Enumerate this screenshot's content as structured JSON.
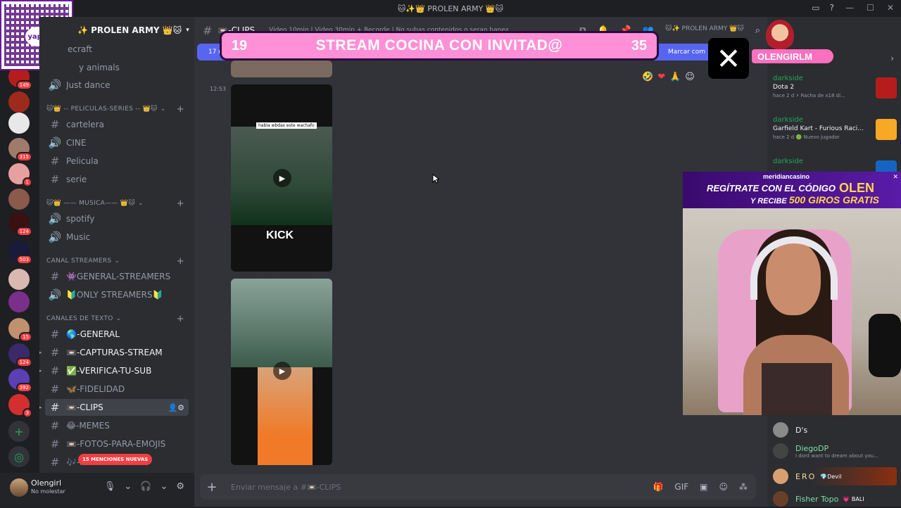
{
  "titlebar": {
    "title": "🐱✨👑 PROLEN ARMY 👑🐱"
  },
  "server": {
    "name": "✨ PROLEN ARMY 👑🐱"
  },
  "rail": {
    "badges": [
      "149",
      "315",
      "1",
      "124",
      "503",
      "15",
      "124",
      "392",
      "3"
    ]
  },
  "sidebar": {
    "channels_top": [
      {
        "label": "ecraft"
      },
      {
        "label": "y animals"
      },
      {
        "label": "Just dance"
      }
    ],
    "cat_peliculas": "🐱👑 -- PELICULAS-SERIES -- 👑🐱",
    "peliculas": [
      {
        "label": "cartelera",
        "icon": "#"
      },
      {
        "label": "CINE",
        "icon": "🔊"
      },
      {
        "label": "Pelicula",
        "icon": "#"
      },
      {
        "label": "serie",
        "icon": "#"
      }
    ],
    "cat_musica": "🐱👑 —— MUSICA—— 👑🐱",
    "musica": [
      {
        "label": "spotify"
      },
      {
        "label": "Music"
      }
    ],
    "cat_streamers": "CANAL STREAMERS",
    "streamers": [
      {
        "label": "👾GENERAL-STREAMERS"
      },
      {
        "label": "🔰ONLY STREAMERS🔰"
      }
    ],
    "cat_texto": "CANALES DE TEXTO",
    "texto": [
      {
        "label": "🌎-GENERAL"
      },
      {
        "label": "📼-CAPTURAS-STREAM"
      },
      {
        "label": "✅-VERIFICA-TU-SUB"
      },
      {
        "label": "🦋-FIDELIDAD"
      },
      {
        "label": "📼-CLIPS"
      },
      {
        "label": "😂-MEMES"
      },
      {
        "label": "📼-FOTOS-PARA-EMOJIS"
      },
      {
        "label": "🎶-M"
      }
    ],
    "mentions": "15 MENCIONES NUEVAS"
  },
  "user": {
    "name": "Olengirl",
    "status": "No molestar"
  },
  "main": {
    "channel": "📼-CLIPS",
    "header_topic": "Video 10min | Video 30min + Recorde | No subas contenidos o seran baneados",
    "banner_left": "17 m",
    "banner_right": "Marcar com",
    "timestamp": "12:53",
    "video1_caption": "habla wbdas este wachafo",
    "video1_brand": "KICK",
    "composer_placeholder": "Enviar mensaje a #📼-CLIPS"
  },
  "overlay": {
    "count_left": "19",
    "title": "STREAM COCINA CON INVITAD@",
    "count_right": "35",
    "streamer_tag": "OLENGIRLM"
  },
  "casino": {
    "brand": "meridiancasino",
    "line1": "REGÍTRATE CON EL CÓDIGO",
    "code": "OLEN",
    "line2_pre": "Y RECIBE ",
    "line2_amount": "500 GIROS GRATIS"
  },
  "activity": [
    {
      "who": "darkside",
      "game": "Dota 2",
      "meta": "hace 2 d ⚡ Racha de x18 dí..."
    },
    {
      "who": "darkside",
      "game": "Garfield Kart - Furious Raci...",
      "meta": "hace 2 d 🟢 Nuevo jugador"
    },
    {
      "who": "darkside",
      "game": "",
      "meta": ""
    }
  ],
  "members": [
    {
      "name": "D's",
      "sub": "",
      "tag": ""
    },
    {
      "name": "DiegoDP",
      "sub": "I dont want to dream about you...",
      "tag": ""
    },
    {
      "name": "ERO",
      "sub": "",
      "tag": "💎Devil"
    },
    {
      "name": "Fisher Topo",
      "sub": "",
      "tag": "💗 BALI"
    }
  ],
  "header_right_text": "🐱✨ PROLEN ARMY 👑🐱"
}
